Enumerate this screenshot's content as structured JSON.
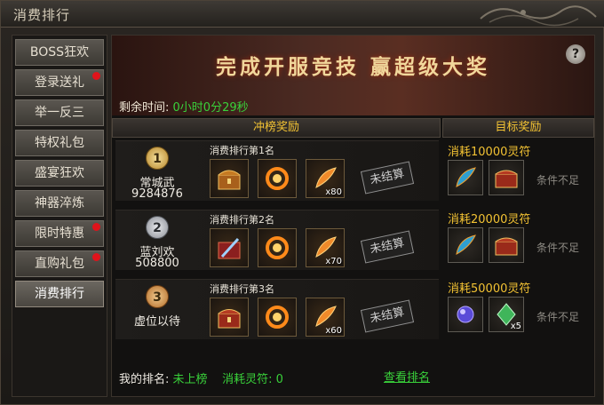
{
  "window": {
    "title": "消费排行"
  },
  "sidebar": {
    "items": [
      {
        "label": "BOSS狂欢",
        "dot": false,
        "active": false
      },
      {
        "label": "登录送礼",
        "dot": true,
        "active": false
      },
      {
        "label": "举一反三",
        "dot": false,
        "active": false
      },
      {
        "label": "特权礼包",
        "dot": false,
        "active": false
      },
      {
        "label": "盛宴狂欢",
        "dot": false,
        "active": false
      },
      {
        "label": "神器淬炼",
        "dot": false,
        "active": false
      },
      {
        "label": "限时特惠",
        "dot": true,
        "active": false
      },
      {
        "label": "直购礼包",
        "dot": true,
        "active": false
      },
      {
        "label": "消费排行",
        "dot": false,
        "active": true
      }
    ]
  },
  "banner": {
    "title": "完成开服竞技 赢超级大奖",
    "help": "?"
  },
  "timer": {
    "label": "剩余时间:",
    "value": "0小时0分29秒"
  },
  "columns": {
    "left": "冲榜奖励",
    "right": "目标奖励"
  },
  "ranks": [
    {
      "medal": "1",
      "medal_color": "gold",
      "name": "常城武",
      "score": "9284876",
      "label": "消费排行第1名",
      "items": [
        {
          "icon": "treasure-chest-icon",
          "qty": ""
        },
        {
          "icon": "fire-ring-icon",
          "qty": ""
        },
        {
          "icon": "feather-icon",
          "qty": "x80"
        }
      ],
      "stamp": "未结算"
    },
    {
      "medal": "2",
      "medal_color": "silver",
      "name": "蓝刘欢",
      "score": "508800",
      "label": "消费排行第2名",
      "items": [
        {
          "icon": "weapon-chest-icon",
          "qty": ""
        },
        {
          "icon": "fire-ring-icon",
          "qty": ""
        },
        {
          "icon": "feather-icon",
          "qty": "x70"
        }
      ],
      "stamp": "未结算"
    },
    {
      "medal": "3",
      "medal_color": "bronze",
      "name": "虚位以待",
      "score": "",
      "label": "消费排行第3名",
      "items": [
        {
          "icon": "red-chest-icon",
          "qty": ""
        },
        {
          "icon": "fire-ring-icon",
          "qty": ""
        },
        {
          "icon": "feather-icon",
          "qty": "x60"
        }
      ],
      "stamp": "未结算"
    }
  ],
  "targets": [
    {
      "title": "消耗10000灵符",
      "items": [
        {
          "icon": "jade-feather-icon",
          "qty": ""
        },
        {
          "icon": "red-chest-icon",
          "qty": ""
        }
      ],
      "condition": "条件不足"
    },
    {
      "title": "消耗20000灵符",
      "items": [
        {
          "icon": "jade-feather-icon",
          "qty": ""
        },
        {
          "icon": "red-chest-icon",
          "qty": ""
        }
      ],
      "condition": "条件不足"
    },
    {
      "title": "消耗50000灵符",
      "items": [
        {
          "icon": "purple-gem-icon",
          "qty": ""
        },
        {
          "icon": "green-crystal-icon",
          "qty": "x5"
        }
      ],
      "condition": "条件不足"
    }
  ],
  "footer": {
    "my_rank_label": "我的排名:",
    "my_rank_value": "未上榜",
    "spent_label": "消耗灵符:",
    "spent_value": "0",
    "view_link": "查看排名"
  },
  "colors": {
    "accent": "#f2c233",
    "green": "#39d13a",
    "notify": "#e0131b"
  }
}
